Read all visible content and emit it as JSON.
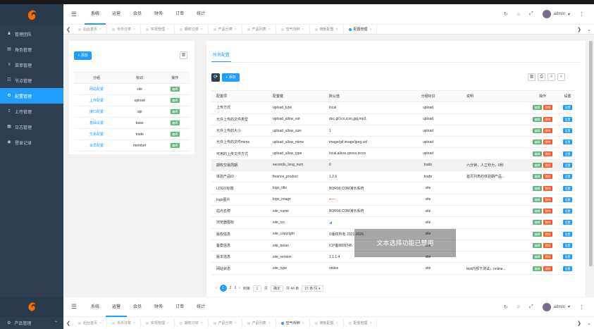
{
  "topnav": [
    "系统",
    "运营",
    "会员",
    "财务",
    "订单",
    "统计"
  ],
  "topnav2": [
    "系统",
    "运营",
    "会员",
    "财务",
    "订单",
    "统计"
  ],
  "user": "admin",
  "sidebar": [
    {
      "icon": "user-icon",
      "label": "管理团队"
    },
    {
      "icon": "role-icon",
      "label": "角色管理"
    },
    {
      "icon": "menu-icon",
      "label": "菜单管理"
    },
    {
      "icon": "node-icon",
      "label": "节点管理"
    },
    {
      "icon": "gear-icon",
      "label": "配置管理",
      "active": true
    },
    {
      "icon": "upload-icon",
      "label": "上传管理"
    },
    {
      "icon": "calendar-icon",
      "label": "日志管理"
    },
    {
      "icon": "eye-icon",
      "label": "登录记录"
    }
  ],
  "sidebar2_item": "产品管理",
  "tabs": [
    "后台首页",
    "币币订单",
    "实现管理",
    "期权订单",
    "产品分类",
    "产品列表",
    "空气币种",
    "牌板配置",
    "配置管理"
  ],
  "tabs2": [
    "后台首页",
    "币币订单",
    "实现管理",
    "期权订单",
    "产品分类",
    "产品列表",
    "空气币种",
    "牌板配置",
    "配置管理"
  ],
  "left": {
    "add": "+ 添加",
    "headers": [
      "分组",
      "标识",
      "操作"
    ],
    "rows": [
      {
        "name": "网站配置",
        "key": "site"
      },
      {
        "name": "上传配置",
        "key": "upload"
      },
      {
        "name": "接口配置",
        "key": "api"
      },
      {
        "name": "基础设置",
        "key": "base"
      },
      {
        "name": "交易配置",
        "key": "trade"
      },
      {
        "name": "会员配置",
        "key": "member"
      }
    ],
    "edit": "编辑"
  },
  "right": {
    "tab": "所有配置",
    "add": "+ 添加",
    "headers": [
      "配置项",
      "配置键",
      "默认值",
      "分组标识",
      "说明",
      "操作",
      "设置"
    ],
    "rows": [
      {
        "item": "上传方式",
        "key": "upload_type",
        "val": "local",
        "group": "upload",
        "desc": ""
      },
      {
        "item": "允许上传的文件类型",
        "key": "upload_allow_ext",
        "val": "doc,gif,ico,icon,jpg,mp3,",
        "group": "upload",
        "desc": ""
      },
      {
        "item": "允许上传的大小",
        "key": "upload_allow_size",
        "val": "1",
        "group": "upload",
        "desc": ""
      },
      {
        "item": "允许上传的文件mime",
        "key": "upload_allow_mime",
        "val": "image/gif,image/jpeg,vid",
        "group": "upload",
        "desc": ""
      },
      {
        "item": "可用的上传文件方式",
        "key": "upload_allow_type",
        "val": "local,alioss,qnoss,txcos",
        "group": "upload",
        "desc": ""
      },
      {
        "item": "期权交易周期",
        "key": "seconds_long_num",
        "val": "0",
        "group": "trade",
        "desc": "六分钟，人立秒为，0秒",
        "hl": true
      },
      {
        "item": "体验产品ID",
        "key": "finance_product",
        "val": "1,2,6",
        "group": "trade",
        "desc": "首页列表的体验期产品..."
      },
      {
        "item": "LOGO标题",
        "key": "logo_title",
        "val": "BOR99.COM演示系统",
        "group": "site",
        "desc": ""
      },
      {
        "item": "logo图片",
        "key": "logo_image",
        "val": "",
        "group": "site",
        "desc": "",
        "arrow": true
      },
      {
        "item": "站点名称",
        "key": "site_name",
        "val": "BOR99.COM演示系统",
        "group": "site",
        "desc": ""
      },
      {
        "item": "浏览器图标",
        "key": "site_ico",
        "val": "",
        "group": "site",
        "desc": "",
        "ico": true
      },
      {
        "item": "版权信息",
        "key": "site_copyright",
        "val": "©版权所有 2021-2026",
        "group": "site",
        "desc": ""
      },
      {
        "item": "备案信息",
        "key": "site_beian",
        "val": "ICP备8899745",
        "group": "site",
        "desc": ""
      },
      {
        "item": "版本信息",
        "key": "site_version",
        "val": "1.1.1.4",
        "group": "site",
        "desc": ""
      },
      {
        "item": "网站状态",
        "key": "site_type",
        "val": "online",
        "group": "site",
        "desc": "test内部下测试，online..."
      }
    ],
    "op_edit": "编辑",
    "op_del": "删除",
    "set": "设置"
  },
  "pager": {
    "pages": [
      "1",
      "2",
      "3"
    ],
    "goto_label": "到第",
    "page_input": "1",
    "page_unit": "页",
    "confirm": "确定",
    "total": "共 44 条",
    "per": "15 条/页"
  },
  "toast": "文本选择功能已禁用"
}
